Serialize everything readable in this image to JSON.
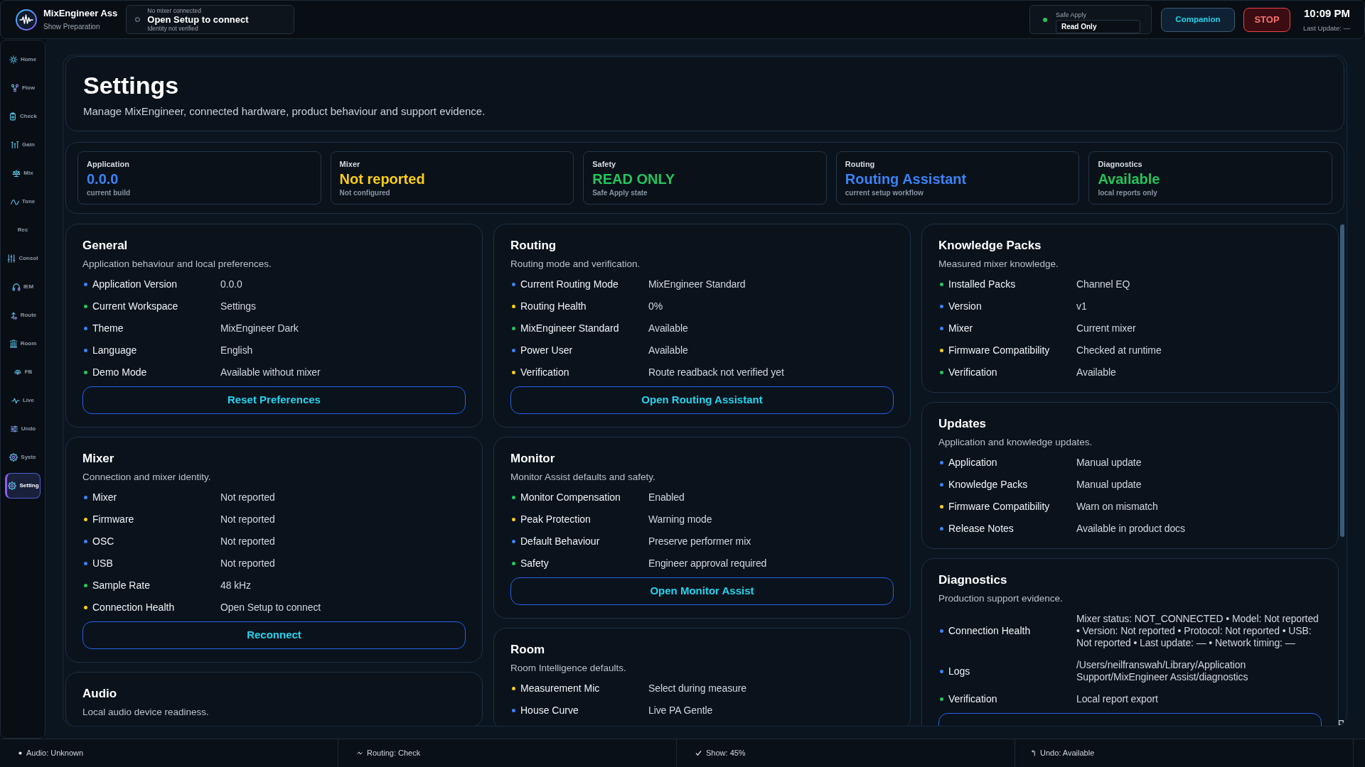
{
  "app": {
    "title": "MixEngineer Ass",
    "subtitle": "Show Preparation"
  },
  "connection": {
    "connected": false,
    "caption": "No mixer connected",
    "status": "Open Setup to connect",
    "detail": "Identity not verified"
  },
  "safe_apply": {
    "on": true,
    "label": "Safe Apply",
    "value": "Read Only"
  },
  "actions": [
    {
      "kind": "companion",
      "label": "Companion"
    },
    {
      "kind": "stop",
      "label": "STOP"
    }
  ],
  "clock": {
    "time": "10:09 PM",
    "last_update": "Last Update: —"
  },
  "sidebar": {
    "items": [
      {
        "label": "Home",
        "selected": false
      },
      {
        "label": "Flow",
        "selected": false
      },
      {
        "label": "Check",
        "selected": false
      },
      {
        "label": "Gain",
        "selected": false
      },
      {
        "label": "Mix",
        "selected": false
      },
      {
        "label": "Tone",
        "selected": false
      },
      {
        "label": "Rec",
        "selected": false
      },
      {
        "label": "Consol",
        "selected": false
      },
      {
        "label": "IEM",
        "selected": false
      },
      {
        "label": "Route",
        "selected": false
      },
      {
        "label": "Room",
        "selected": false
      },
      {
        "label": "FB",
        "selected": false
      },
      {
        "label": "Live",
        "selected": false
      },
      {
        "label": "Undo",
        "selected": false
      },
      {
        "label": "Syste",
        "selected": false
      },
      {
        "label": "Setting",
        "selected": true
      }
    ]
  },
  "page": {
    "title": "Settings",
    "subtitle": "Manage MixEngineer, connected hardware, product behaviour and support evidence."
  },
  "summary": [
    {
      "label": "Application",
      "value": "0.0.0",
      "caption": "current build",
      "color": "#3b82f6"
    },
    {
      "label": "Mixer",
      "value": "Not reported",
      "caption": "Not configured",
      "color": "#facc15"
    },
    {
      "label": "Safety",
      "value": "READ ONLY",
      "caption": "Safe Apply state",
      "color": "#22c55e"
    },
    {
      "label": "Routing",
      "value": "Routing Assistant",
      "caption": "current setup workflow",
      "color": "#3b82f6"
    },
    {
      "label": "Diagnostics",
      "value": "Available",
      "caption": "local reports only",
      "color": "#22c55e"
    }
  ],
  "columns": [
    {
      "sections": [
        {
          "title": "General",
          "description": "Application behaviour and local preferences.",
          "rows": [
            {
              "label": "Application Version",
              "value": "0.0.0",
              "color": "#3b82f6"
            },
            {
              "label": "Current Workspace",
              "value": "Settings",
              "color": "#22c55e"
            },
            {
              "label": "Theme",
              "value": "MixEngineer Dark",
              "color": "#3b82f6"
            },
            {
              "label": "Language",
              "value": "English",
              "color": "#3b82f6"
            },
            {
              "label": "Demo Mode",
              "value": "Available without mixer",
              "color": "#22c55e"
            }
          ],
          "button": "Reset Preferences"
        },
        {
          "title": "Mixer",
          "description": "Connection and mixer identity.",
          "rows": [
            {
              "label": "Mixer",
              "value": "Not reported",
              "color": "#3b82f6"
            },
            {
              "label": "Firmware",
              "value": "Not reported",
              "color": "#facc15"
            },
            {
              "label": "OSC",
              "value": "Not reported",
              "color": "#3b82f6"
            },
            {
              "label": "USB",
              "value": "Not reported",
              "color": "#3b82f6"
            },
            {
              "label": "Sample Rate",
              "value": "48 kHz",
              "color": "#22c55e"
            },
            {
              "label": "Connection Health",
              "value": "Open Setup to connect",
              "color": "#facc15"
            }
          ],
          "button": "Reconnect"
        },
        {
          "title": "Audio",
          "description": "Local audio device readiness."
        }
      ]
    },
    {
      "sections": [
        {
          "title": "Routing",
          "description": "Routing mode and verification.",
          "rows": [
            {
              "label": "Current Routing Mode",
              "value": "MixEngineer Standard",
              "color": "#3b82f6"
            },
            {
              "label": "Routing Health",
              "value": "0%",
              "color": "#facc15"
            },
            {
              "label": "MixEngineer Standard",
              "value": "Available",
              "color": "#22c55e"
            },
            {
              "label": "Power User",
              "value": "Available",
              "color": "#3b82f6"
            },
            {
              "label": "Verification",
              "value": "Route readback not verified yet",
              "color": "#facc15"
            }
          ],
          "button": "Open Routing Assistant"
        },
        {
          "title": "Monitor",
          "description": "Monitor Assist defaults and safety.",
          "rows": [
            {
              "label": "Monitor Compensation",
              "value": "Enabled",
              "color": "#22c55e"
            },
            {
              "label": "Peak Protection",
              "value": "Warning mode",
              "color": "#facc15"
            },
            {
              "label": "Default Behaviour",
              "value": "Preserve performer mix",
              "color": "#3b82f6"
            },
            {
              "label": "Safety",
              "value": "Engineer approval required",
              "color": "#22c55e"
            }
          ],
          "button": "Open Monitor Assist"
        },
        {
          "title": "Room",
          "description": "Room Intelligence defaults.",
          "rows": [
            {
              "label": "Measurement Mic",
              "value": "Select during measure",
              "color": "#facc15"
            },
            {
              "label": "House Curve",
              "value": "Live PA Gentle",
              "color": "#3b82f6"
            }
          ]
        }
      ]
    },
    {
      "sections": [
        {
          "title": "Knowledge Packs",
          "description": "Measured mixer knowledge.",
          "rows": [
            {
              "label": "Installed Packs",
              "value": "Channel EQ",
              "color": "#22c55e"
            },
            {
              "label": "Version",
              "value": "v1",
              "color": "#3b82f6"
            },
            {
              "label": "Mixer",
              "value": "Current mixer",
              "color": "#3b82f6"
            },
            {
              "label": "Firmware Compatibility",
              "value": "Checked at runtime",
              "color": "#facc15"
            },
            {
              "label": "Verification",
              "value": "Available",
              "color": "#22c55e"
            }
          ]
        },
        {
          "title": "Updates",
          "description": "Application and knowledge updates.",
          "rows": [
            {
              "label": "Application",
              "value": "Manual update",
              "color": "#3b82f6"
            },
            {
              "label": "Knowledge Packs",
              "value": "Manual update",
              "color": "#3b82f6"
            },
            {
              "label": "Firmware Compatibility",
              "value": "Warn on mismatch",
              "color": "#facc15"
            },
            {
              "label": "Release Notes",
              "value": "Available in product docs",
              "color": "#3b82f6"
            }
          ]
        },
        {
          "title": "Diagnostics",
          "description": "Production support evidence.",
          "rows": [
            {
              "label": "Connection Health",
              "value": "Mixer status: NOT_CONNECTED • Model: Not reported • Version: Not reported • Protocol: Not reported • USB: Not reported • Last update: — • Network timing: —",
              "color": "#3b82f6"
            },
            {
              "label": "Logs",
              "value": "/Users/neilfranswah/Library/Application Support/MixEngineer Assist/diagnostics",
              "color": "#3b82f6"
            },
            {
              "label": "Verification",
              "value": "Local report export",
              "color": "#22c55e"
            }
          ],
          "button_cut_off": true
        }
      ]
    }
  ],
  "status_bar": [
    "Audio: Unknown",
    "Routing: Check",
    "Show: 45%",
    "Undo: Available"
  ]
}
